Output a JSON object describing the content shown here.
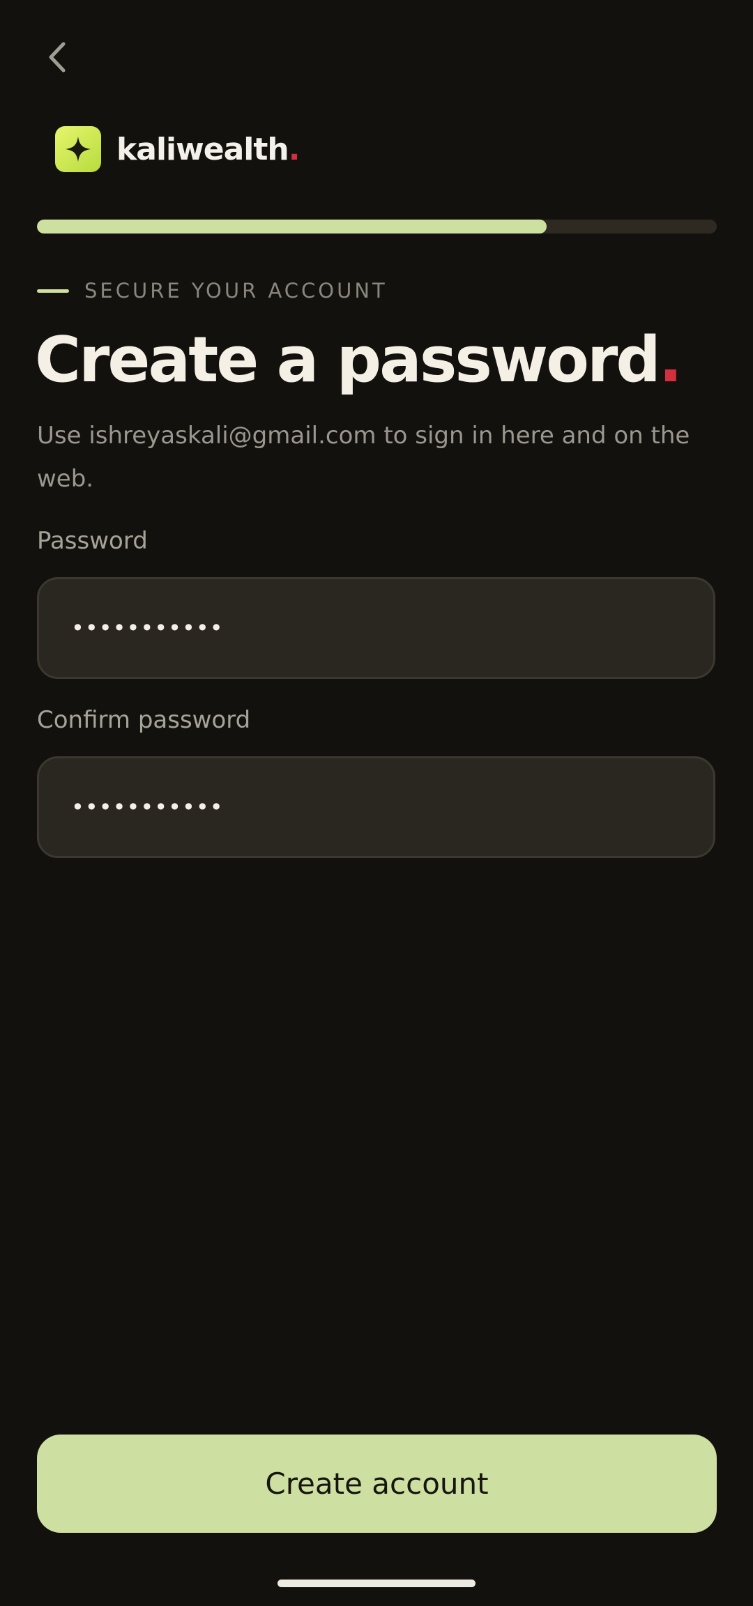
{
  "nav": {
    "back_icon": "chevron-left-icon"
  },
  "brand": {
    "logo_icon": "sparkle-icon",
    "name": "kaliwealth",
    "dot": ".",
    "accent_color": "#d22f3f",
    "logo_color": "#c9e84c"
  },
  "progress": {
    "fraction": 0.75,
    "fill_color": "#cde0a0"
  },
  "header": {
    "eyebrow": "SECURE YOUR ACCOUNT",
    "title": "Create a password",
    "title_dot": ".",
    "subtitle": "Use ishreyaskali@gmail.com to sign in here and on the web."
  },
  "form": {
    "password": {
      "label": "Password",
      "value": "•••••••••••"
    },
    "confirm_password": {
      "label": "Confirm password",
      "value": "•••••••••••"
    }
  },
  "actions": {
    "submit_label": "Create account",
    "submit_color": "#cde0a2"
  }
}
